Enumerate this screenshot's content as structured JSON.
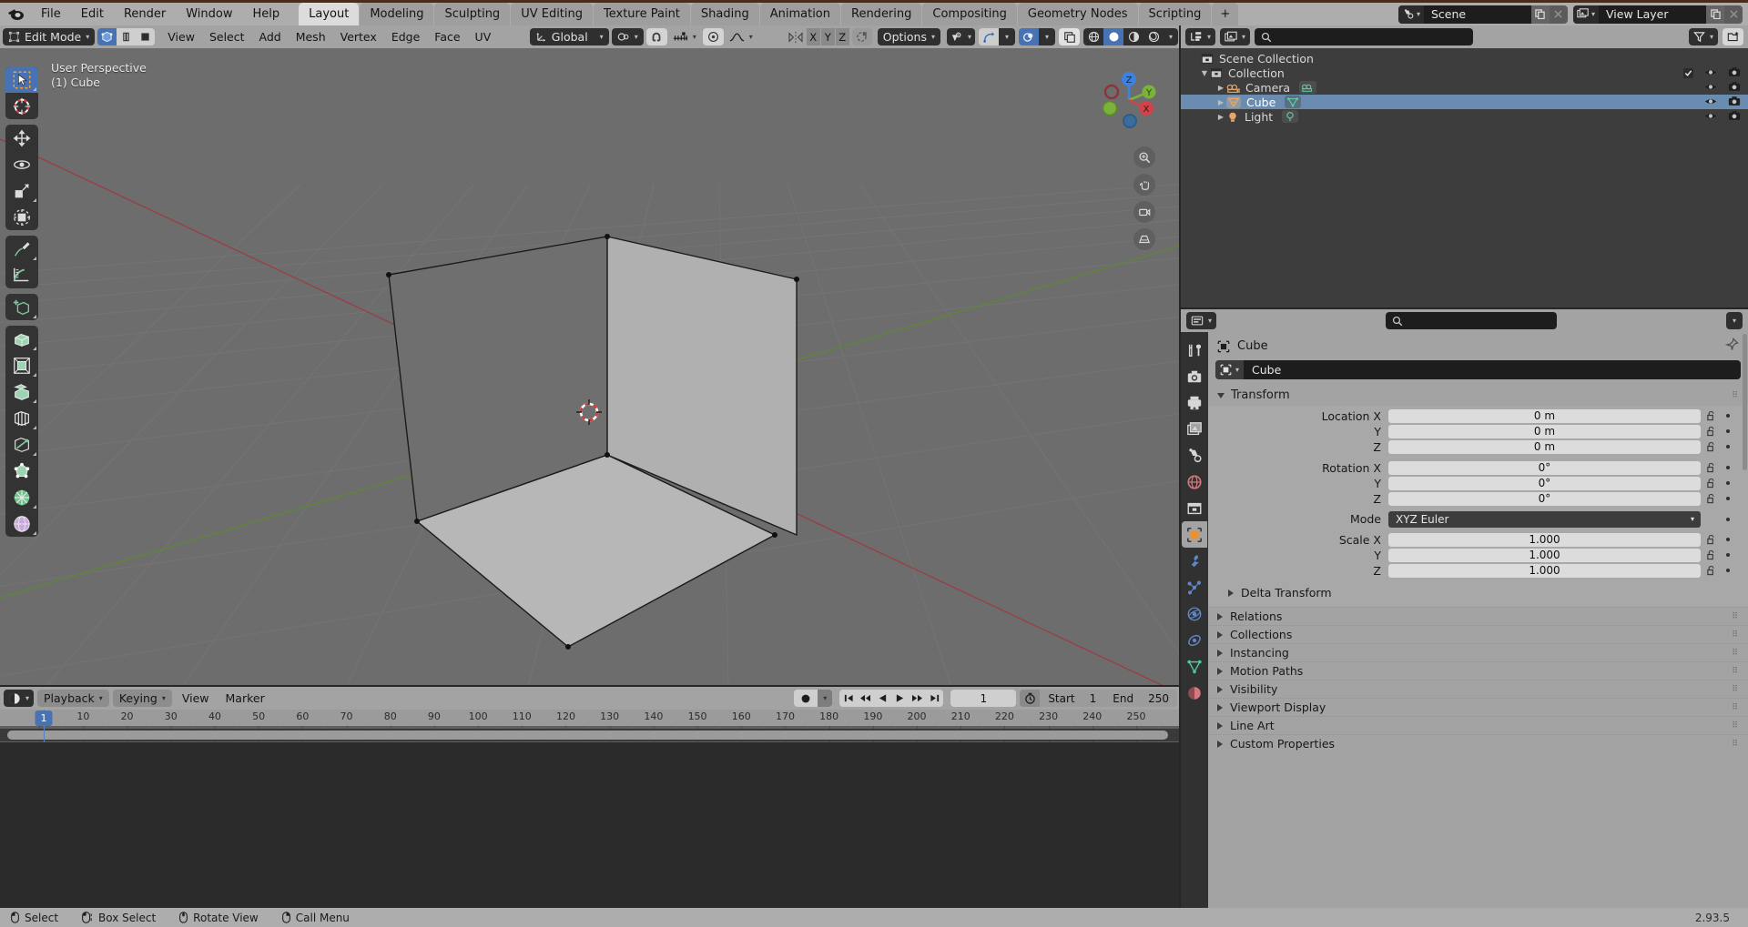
{
  "app": {
    "version": "2.93.5"
  },
  "topbar": {
    "logo_icon": "blender-logo-icon",
    "menus": [
      "File",
      "Edit",
      "Render",
      "Window",
      "Help"
    ],
    "workspace_tabs": [
      "Layout",
      "Modeling",
      "Sculpting",
      "UV Editing",
      "Texture Paint",
      "Shading",
      "Animation",
      "Rendering",
      "Compositing",
      "Geometry Nodes",
      "Scripting"
    ],
    "active_workspace": "Layout",
    "add_workspace_label": "+",
    "scene": {
      "icon": "scene-icon",
      "name": "Scene",
      "new_icon": "duplicate-icon",
      "unlink_icon": "x-icon"
    },
    "view_layer": {
      "icon": "view-layer-icon",
      "name": "View Layer",
      "new_icon": "duplicate-icon",
      "unlink_icon": "x-icon"
    }
  },
  "viewport_header": {
    "mode": "Edit Mode",
    "mode_icon": "edit-mode-icon",
    "select_modes": [
      "vertex-select-icon",
      "edge-select-icon",
      "face-select-icon"
    ],
    "active_select_mode": "vertex-select-icon",
    "menus": [
      "View",
      "Select",
      "Add",
      "Mesh",
      "Vertex",
      "Edge",
      "Face",
      "UV"
    ],
    "transform_orientation": "Global",
    "orientation_icon": "orientation-gizmo-icon",
    "pivot_icon": "pivot-point-icon",
    "snap_icon": "magnet-icon",
    "snap_target_icon": "snap-increment-icon",
    "proportional_icon": "proportional-edit-icon",
    "falloff_icon": "smooth-falloff-icon",
    "mirror_label_x": "X",
    "mirror_label_y": "Y",
    "mirror_label_z": "Z",
    "mirror_icon": "mirror-icon",
    "uv_mirror_icon": "uv-mirror-icon",
    "options_label": "Options",
    "overlays": {
      "visibility_icon": "object-types-visibility-icon",
      "gizmo_icon": "gizmo-icon",
      "overlay_icon": "overlays-icon",
      "xray_icon": "xray-toggle-icon",
      "shading_modes": [
        "wireframe-shading-icon",
        "solid-shading-icon",
        "material-preview-icon",
        "rendered-shading-icon"
      ],
      "active_shading": "solid-shading-icon"
    }
  },
  "viewport": {
    "perspective_label": "User Perspective",
    "object_label": "(1) Cube",
    "gizmo_axes": [
      "Z",
      "Y",
      "X"
    ],
    "nav_buttons": [
      "zoom-icon",
      "pan-icon",
      "camera-view-icon",
      "toggle-perspective-icon"
    ],
    "toolbar": [
      {
        "name": "tweak-tool",
        "active": true
      },
      {
        "name": "cursor-tool",
        "active": false
      },
      {
        "name": "move-tool",
        "active": false
      },
      {
        "name": "rotate-tool",
        "active": false
      },
      {
        "name": "scale-tool",
        "active": false
      },
      {
        "name": "transform-tool",
        "active": false
      },
      {
        "name": "annotate-tool",
        "active": false
      },
      {
        "name": "measure-tool",
        "active": false
      },
      {
        "name": "add-cube-tool",
        "active": false
      },
      {
        "name": "extrude-region-tool",
        "active": false
      },
      {
        "name": "inset-faces-tool",
        "active": false
      },
      {
        "name": "bevel-tool",
        "active": false
      },
      {
        "name": "loop-cut-tool",
        "active": false
      },
      {
        "name": "knife-tool",
        "active": false
      },
      {
        "name": "poly-build-tool",
        "active": false
      },
      {
        "name": "spin-tool",
        "active": false
      },
      {
        "name": "smooth-tool",
        "active": false
      }
    ]
  },
  "outliner": {
    "display_mode_icon": "outliner-display-mode-icon",
    "filter_id_icon": "id-type-filter-icon",
    "search_icon": "search-icon",
    "search_placeholder": "",
    "filter_icon": "funnel-filter-icon",
    "new_collection_icon": "new-collection-icon",
    "rows": [
      {
        "label": "Scene Collection",
        "icon": "scene-collection-icon",
        "indent": 0,
        "expander": "",
        "selected": false,
        "has_checkbox": false,
        "data_icon": "",
        "eye_icon": "eye-icon",
        "camera_icon": "camera-render-icon"
      },
      {
        "label": "Collection",
        "icon": "collection-icon",
        "indent": 1,
        "expander": "down",
        "selected": false,
        "has_checkbox": true,
        "data_icon": "",
        "eye_icon": "eye-icon",
        "camera_icon": "camera-render-icon"
      },
      {
        "label": "Camera",
        "icon": "camera-object-icon",
        "indent": 2,
        "expander": "right",
        "selected": false,
        "has_checkbox": false,
        "data_icon": "camera-data-icon",
        "eye_icon": "eye-icon",
        "camera_icon": "camera-render-icon"
      },
      {
        "label": "Cube",
        "icon": "mesh-object-icon",
        "indent": 2,
        "expander": "right",
        "selected": true,
        "has_checkbox": false,
        "data_icon": "mesh-data-icon",
        "eye_icon": "eye-icon",
        "camera_icon": "camera-render-icon"
      },
      {
        "label": "Light",
        "icon": "light-object-icon",
        "indent": 2,
        "expander": "right",
        "selected": false,
        "has_checkbox": false,
        "data_icon": "light-data-icon",
        "eye_icon": "eye-icon",
        "camera_icon": "camera-render-icon"
      }
    ]
  },
  "properties": {
    "editor_icon": "properties-editor-icon",
    "search_icon": "search-icon",
    "search_placeholder": "",
    "breadcrumb_icon": "object-properties-icon",
    "breadcrumb": "Cube",
    "pin_icon": "pin-icon",
    "id_icon": "object-icon",
    "id_name": "Cube",
    "tabs": [
      {
        "name": "tool-tab",
        "icon": "tool-icon",
        "active": false
      },
      {
        "name": "render-tab",
        "icon": "render-camera-icon",
        "active": false
      },
      {
        "name": "output-tab",
        "icon": "printer-output-icon",
        "active": false
      },
      {
        "name": "view-layer-tab",
        "icon": "view-layer-images-icon",
        "active": false
      },
      {
        "name": "scene-tab",
        "icon": "scene-cone-icon",
        "active": false
      },
      {
        "name": "world-tab",
        "icon": "world-globe-icon",
        "active": false
      },
      {
        "name": "collection-tab",
        "icon": "collection-box-icon",
        "active": false
      },
      {
        "name": "object-tab",
        "icon": "object-orange-square-icon",
        "active": true
      },
      {
        "name": "modifiers-tab",
        "icon": "wrench-icon",
        "active": false
      },
      {
        "name": "particles-tab",
        "icon": "particles-icon",
        "active": false
      },
      {
        "name": "physics-tab",
        "icon": "physics-orbit-icon",
        "active": false
      },
      {
        "name": "constraints-tab",
        "icon": "constraints-icon",
        "active": false
      },
      {
        "name": "data-tab",
        "icon": "mesh-data-green-icon",
        "active": false
      },
      {
        "name": "material-tab",
        "icon": "material-sphere-icon",
        "active": false
      }
    ],
    "transform_panel": {
      "title": "Transform",
      "rows": [
        {
          "label": "Location X",
          "value": "0 m",
          "type": "number"
        },
        {
          "label": "Y",
          "value": "0 m",
          "type": "number"
        },
        {
          "label": "Z",
          "value": "0 m",
          "type": "number"
        },
        {
          "label": "Rotation X",
          "value": "0°",
          "type": "number"
        },
        {
          "label": "Y",
          "value": "0°",
          "type": "number"
        },
        {
          "label": "Z",
          "value": "0°",
          "type": "number"
        },
        {
          "label": "Mode",
          "value": "XYZ Euler",
          "type": "enum"
        },
        {
          "label": "Scale X",
          "value": "1.000",
          "type": "number"
        },
        {
          "label": "Y",
          "value": "1.000",
          "type": "number"
        },
        {
          "label": "Z",
          "value": "1.000",
          "type": "number"
        }
      ],
      "subpanel": "Delta Transform"
    },
    "closed_panels": [
      "Relations",
      "Collections",
      "Instancing",
      "Motion Paths",
      "Visibility",
      "Viewport Display",
      "Line Art",
      "Custom Properties"
    ]
  },
  "timeline": {
    "editor_icon": "timeline-editor-icon",
    "menus": [
      "Playback",
      "Keying",
      "View",
      "Marker"
    ],
    "dropdown_menus": [
      "Playback",
      "Keying"
    ],
    "plain_menus": [
      "View",
      "Marker"
    ],
    "record_icon": "auto-keying-record-icon",
    "transport": [
      "jump-to-start-icon",
      "jump-prev-keyframe-icon",
      "play-reverse-icon",
      "play-icon",
      "jump-next-keyframe-icon",
      "jump-to-end-icon"
    ],
    "current_frame": "1",
    "use_preview_range_icon": "stopwatch-icon",
    "start_label": "Start",
    "start_value": "1",
    "end_label": "End",
    "end_value": "250",
    "ruler_ticks": [
      "1",
      "10",
      "20",
      "30",
      "40",
      "50",
      "60",
      "70",
      "80",
      "90",
      "100",
      "110",
      "120",
      "130",
      "140",
      "150",
      "160",
      "170",
      "180",
      "190",
      "200",
      "210",
      "220",
      "230",
      "240",
      "250"
    ],
    "playhead_frame": "1"
  },
  "statusbar": {
    "items": [
      {
        "icon": "mouse-left-icon",
        "label": "Select"
      },
      {
        "icon": "mouse-left-drag-icon",
        "label": "Box Select"
      },
      {
        "icon": "mouse-middle-icon",
        "label": "Rotate View"
      },
      {
        "icon": "mouse-right-icon",
        "label": "Call Menu"
      }
    ],
    "version": "2.93.5"
  },
  "colors": {
    "accent_blue": "#4772b3",
    "header_grey": "#a3a3a3",
    "topbar_grey": "#adadad",
    "viewport_bg": "#6d6d6d",
    "outliner_bg": "#3d3d3d",
    "selected_row": "#6a8cb0",
    "axis_x_red": "#cf4449",
    "axis_y_green": "#7bb33a",
    "axis_z_blue": "#3d82e0"
  }
}
